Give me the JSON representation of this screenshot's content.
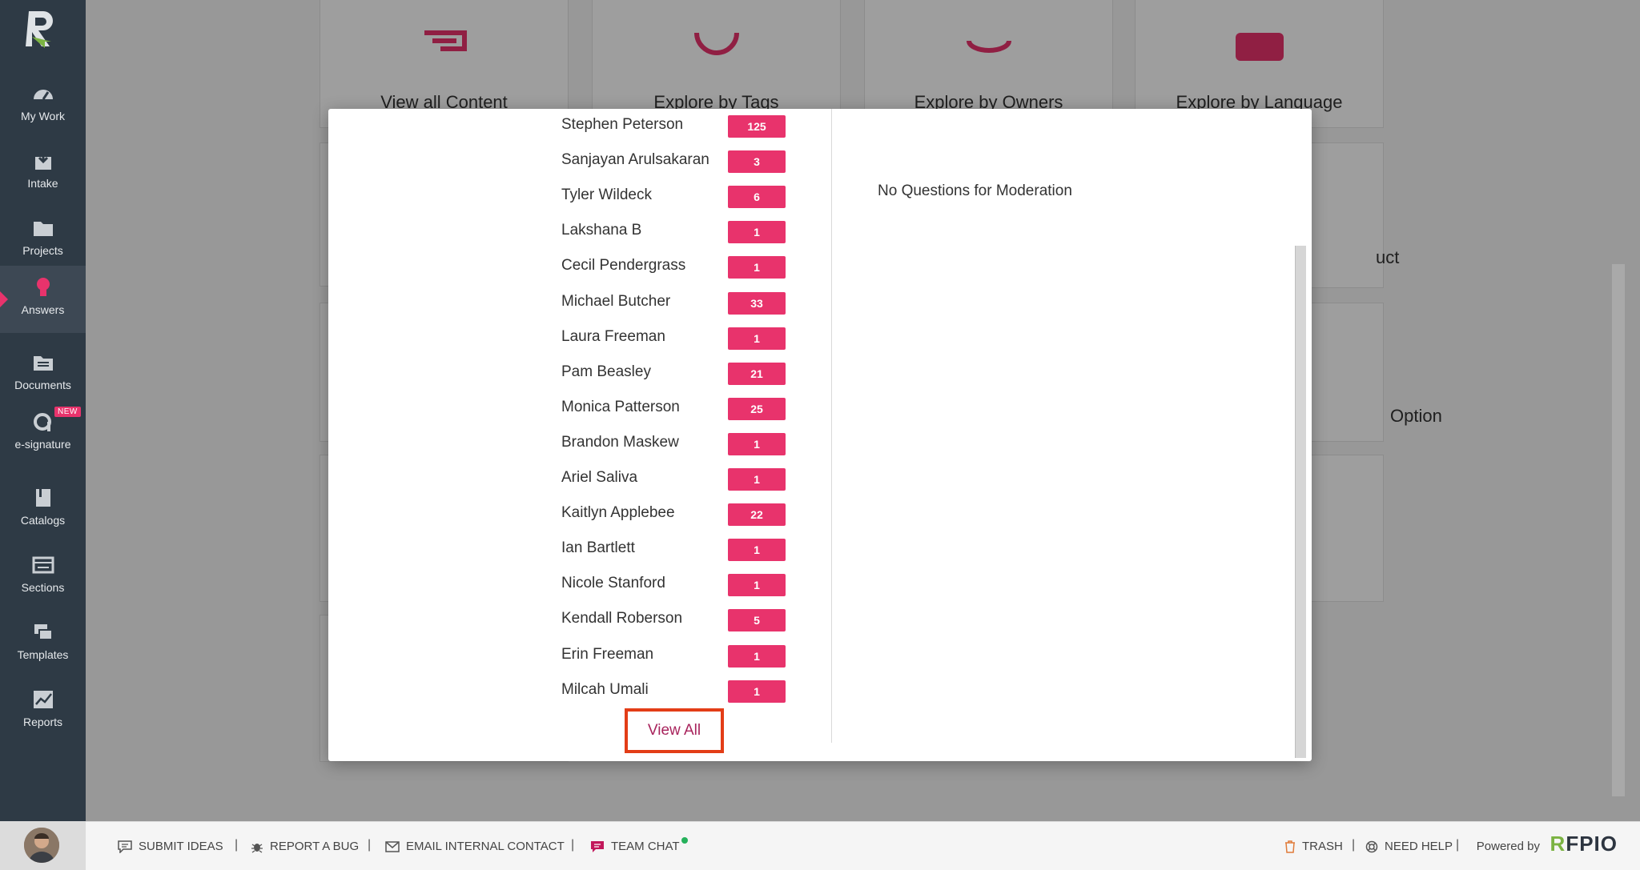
{
  "sidebar": {
    "items": [
      {
        "label": "My Work",
        "icon": "dashboard-icon"
      },
      {
        "label": "Intake",
        "icon": "intake-icon"
      },
      {
        "label": "Projects",
        "icon": "projects-folder-icon"
      },
      {
        "label": "Answers",
        "icon": "lightbulb-icon",
        "active": true
      },
      {
        "label": "Documents",
        "icon": "documents-folder-icon"
      },
      {
        "label": "e-signature",
        "icon": "esignature-icon",
        "badge": "NEW"
      },
      {
        "label": "Catalogs",
        "icon": "catalogs-icon"
      },
      {
        "label": "Sections",
        "icon": "sections-icon"
      },
      {
        "label": "Templates",
        "icon": "templates-icon"
      },
      {
        "label": "Reports",
        "icon": "reports-chart-icon"
      }
    ]
  },
  "background": {
    "cards": [
      "View all Content",
      "Explore by Tags",
      "Explore by Owners",
      "Explore by Language"
    ],
    "fragments": [
      "uct",
      "Option"
    ]
  },
  "modal": {
    "owners": [
      {
        "name": "Stephen Peterson",
        "count": "125"
      },
      {
        "name": "Sanjayan Arulsakaran",
        "count": "3"
      },
      {
        "name": "Tyler Wildeck",
        "count": "6"
      },
      {
        "name": "Lakshana B",
        "count": "1"
      },
      {
        "name": "Cecil Pendergrass",
        "count": "1"
      },
      {
        "name": "Michael Butcher",
        "count": "33"
      },
      {
        "name": "Laura Freeman",
        "count": "1"
      },
      {
        "name": "Pam Beasley",
        "count": "21"
      },
      {
        "name": "Monica Patterson",
        "count": "25"
      },
      {
        "name": "Brandon Maskew",
        "count": "1"
      },
      {
        "name": "Ariel Saliva",
        "count": "1"
      },
      {
        "name": "Kaitlyn Applebee",
        "count": "22"
      },
      {
        "name": "Ian Bartlett",
        "count": "1"
      },
      {
        "name": "Nicole Stanford",
        "count": "1"
      },
      {
        "name": "Kendall Roberson",
        "count": "5"
      },
      {
        "name": "Erin Freeman",
        "count": "1"
      },
      {
        "name": "Milcah Umali",
        "count": "1"
      }
    ],
    "view_all_label": "View All",
    "moderation_text": "No Questions for Moderation"
  },
  "footer": {
    "submit_ideas": "SUBMIT IDEAS",
    "report_bug": "REPORT A BUG",
    "email_contact": "EMAIL INTERNAL CONTACT",
    "team_chat": "TEAM CHAT",
    "trash": "TRASH",
    "need_help": "NEED HELP",
    "powered_by": "Powered by",
    "brand": "RFPIO"
  },
  "colors": {
    "accent": "#e8336c",
    "sidebar_bg": "#2e3a45",
    "highlight_box": "#e33d17",
    "online": "#25b15b"
  }
}
